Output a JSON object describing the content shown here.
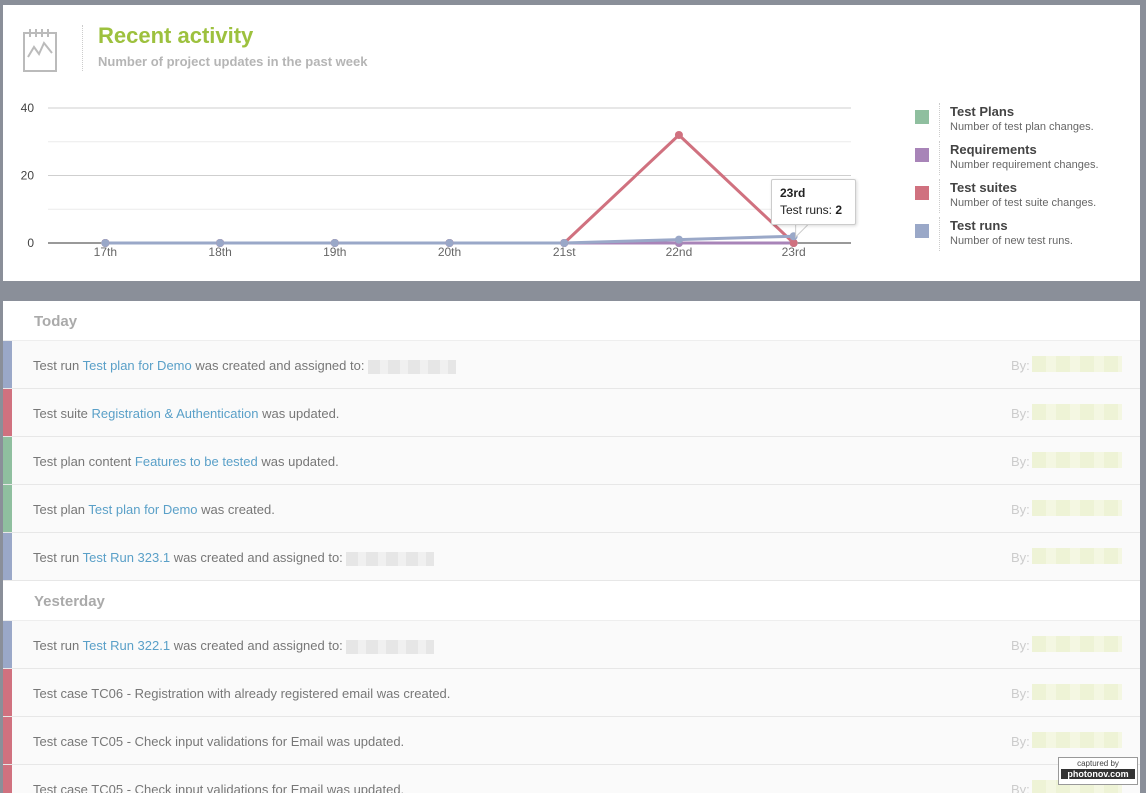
{
  "header": {
    "title": "Recent activity",
    "subtitle": "Number of project updates in the past week",
    "icon": "activity-chart-icon"
  },
  "chart_data": {
    "type": "line",
    "x": [
      "17th",
      "18th",
      "19th",
      "20th",
      "21st",
      "22nd",
      "23rd"
    ],
    "yticks": [
      0,
      20,
      40
    ],
    "ylim": [
      0,
      40
    ],
    "grid": true,
    "legend_position": "right",
    "series": [
      {
        "name": "Test Plans",
        "description": "Number of test plan changes.",
        "color": "#8fbf9f",
        "values": [
          0,
          0,
          0,
          0,
          0,
          0,
          0
        ]
      },
      {
        "name": "Requirements",
        "description": "Number requirement changes.",
        "color": "#a884b8",
        "values": [
          0,
          0,
          0,
          0,
          0,
          0,
          0
        ]
      },
      {
        "name": "Test suites",
        "description": "Number of test suite changes.",
        "color": "#d0717f",
        "values": [
          0,
          0,
          0,
          0,
          0,
          32,
          0
        ]
      },
      {
        "name": "Test runs",
        "description": "Number of new test runs.",
        "color": "#9aa8c8",
        "values": [
          0,
          0,
          0,
          0,
          0,
          1,
          2
        ]
      }
    ]
  },
  "tooltip": {
    "day": "23rd",
    "label": "Test runs:",
    "value": "2"
  },
  "activity": {
    "by_label": "By:",
    "groups": [
      {
        "title": "Today",
        "rows": [
          {
            "color": "#9aa8c8",
            "prefix": "Test run ",
            "link": "Test plan for Demo",
            "suffix": " was created and assigned to: "
          },
          {
            "color": "#d0717f",
            "prefix": "Test suite ",
            "link": "Registration & Authentication",
            "suffix": " was updated."
          },
          {
            "color": "#8fbf9f",
            "prefix": "Test plan content ",
            "link": "Features to be tested",
            "suffix": " was updated."
          },
          {
            "color": "#8fbf9f",
            "prefix": "Test plan ",
            "link": "Test plan for Demo",
            "suffix": " was created."
          },
          {
            "color": "#9aa8c8",
            "prefix": "Test run ",
            "link": "Test Run 323.1",
            "suffix": " was created and assigned to: "
          }
        ]
      },
      {
        "title": "Yesterday",
        "rows": [
          {
            "color": "#9aa8c8",
            "prefix": "Test run ",
            "link": "Test Run 322.1",
            "suffix": " was created and assigned to: "
          },
          {
            "color": "#d0717f",
            "prefix": "Test case TC06 - Registration with already registered email was created.",
            "link": "",
            "suffix": ""
          },
          {
            "color": "#d0717f",
            "prefix": "Test case TC05 - Check input validations for Email was updated.",
            "link": "",
            "suffix": ""
          },
          {
            "color": "#d0717f",
            "prefix": "Test case TC05 - Check input validations for Email was updated.",
            "link": "",
            "suffix": ""
          }
        ]
      }
    ]
  },
  "watermark": {
    "top": "captured by",
    "bottom": "photonov.com"
  }
}
